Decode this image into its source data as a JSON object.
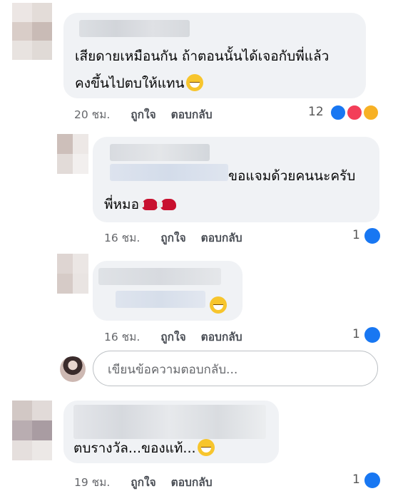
{
  "colors": {
    "bubble": "#f0f2f5",
    "like": "#1877f2",
    "love": "#f33e58",
    "haha": "#f7b125",
    "meta_text": "#65676b"
  },
  "comments": [
    {
      "text_line1": "เสียดายเหมือนกัน ถ้าตอนนั้นได้เจอกับพี่แล้ว",
      "text_line2": "คงขึ้นไปตบให้แทน",
      "emoji": "grinning-face-icon",
      "time": "20 ชม.",
      "like_label": "ถูกใจ",
      "reply_label": "ตอบกลับ",
      "reaction_count": "12",
      "reactions": [
        "like-icon",
        "love-icon",
        "haha-icon"
      ]
    },
    {
      "text_line1": "ขอแจมด้วยคนนะครับ",
      "text_line2": "พี่หมอ",
      "emoji": "boxing-glove-icon",
      "time": "16 ชม.",
      "like_label": "ถูกใจ",
      "reply_label": "ตอบกลับ",
      "reaction_count": "1",
      "reactions": [
        "like-icon"
      ]
    },
    {
      "emoji": "grinning-face-icon",
      "time": "16 ชม.",
      "like_label": "ถูกใจ",
      "reply_label": "ตอบกลับ",
      "reaction_count": "1",
      "reactions": [
        "like-icon"
      ]
    },
    {
      "text_line1": "ตบรางวัล...ของแท้...",
      "emoji": "grinning-sweat-icon",
      "time": "19 ชม.",
      "like_label": "ถูกใจ",
      "reply_label": "ตอบกลับ",
      "reaction_count": "1",
      "reactions": [
        "like-icon"
      ]
    }
  ],
  "reply_box": {
    "placeholder": "เขียนข้อความตอบกลับ..."
  }
}
